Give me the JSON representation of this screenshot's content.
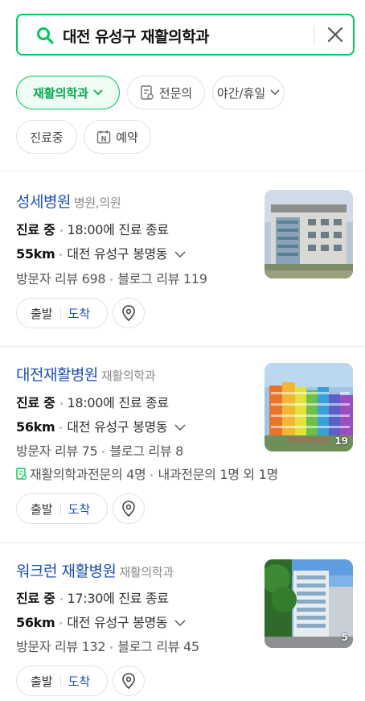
{
  "search": {
    "query": "대전 유성구 재활의학과"
  },
  "filters": [
    {
      "label": "재활의학과",
      "active": true
    },
    {
      "label": "전문의"
    },
    {
      "label": "야간/휴일"
    },
    {
      "label": "진료중"
    },
    {
      "label": "예약"
    }
  ],
  "results": [
    {
      "name": "성세병원",
      "category": "병원,의원",
      "status": "진료 중",
      "hours": "18:00에 진료 종료",
      "distance": "55km",
      "address": "대전 유성구 봉명동",
      "visitor_reviews": "방문자 리뷰 698",
      "blog_reviews": "블로그 리뷰 119",
      "depart_label": "출발",
      "arrive_label": "도착"
    },
    {
      "name": "대전재활병원",
      "category": "재활의학과",
      "status": "진료 중",
      "hours": "18:00에 진료 종료",
      "distance": "56km",
      "address": "대전 유성구 봉명동",
      "visitor_reviews": "방문자 리뷰 75",
      "blog_reviews": "블로그 리뷰 8",
      "specialists": "재활의학과전문의 4명",
      "specialists_extra": "내과전문의 1명 외 1명",
      "photo_count": "19",
      "depart_label": "출발",
      "arrive_label": "도착"
    },
    {
      "name": "워크런 재활병원",
      "category": "재활의학과",
      "status": "진료 중",
      "hours": "17:30에 진료 종료",
      "distance": "56km",
      "address": "대전 유성구 봉명동",
      "visitor_reviews": "방문자 리뷰 132",
      "blog_reviews": "블로그 리뷰 45",
      "photo_count": "5",
      "depart_label": "출발",
      "arrive_label": "도착"
    }
  ],
  "colors": {
    "accent": "#03c75a",
    "link": "#1a4fb4"
  }
}
